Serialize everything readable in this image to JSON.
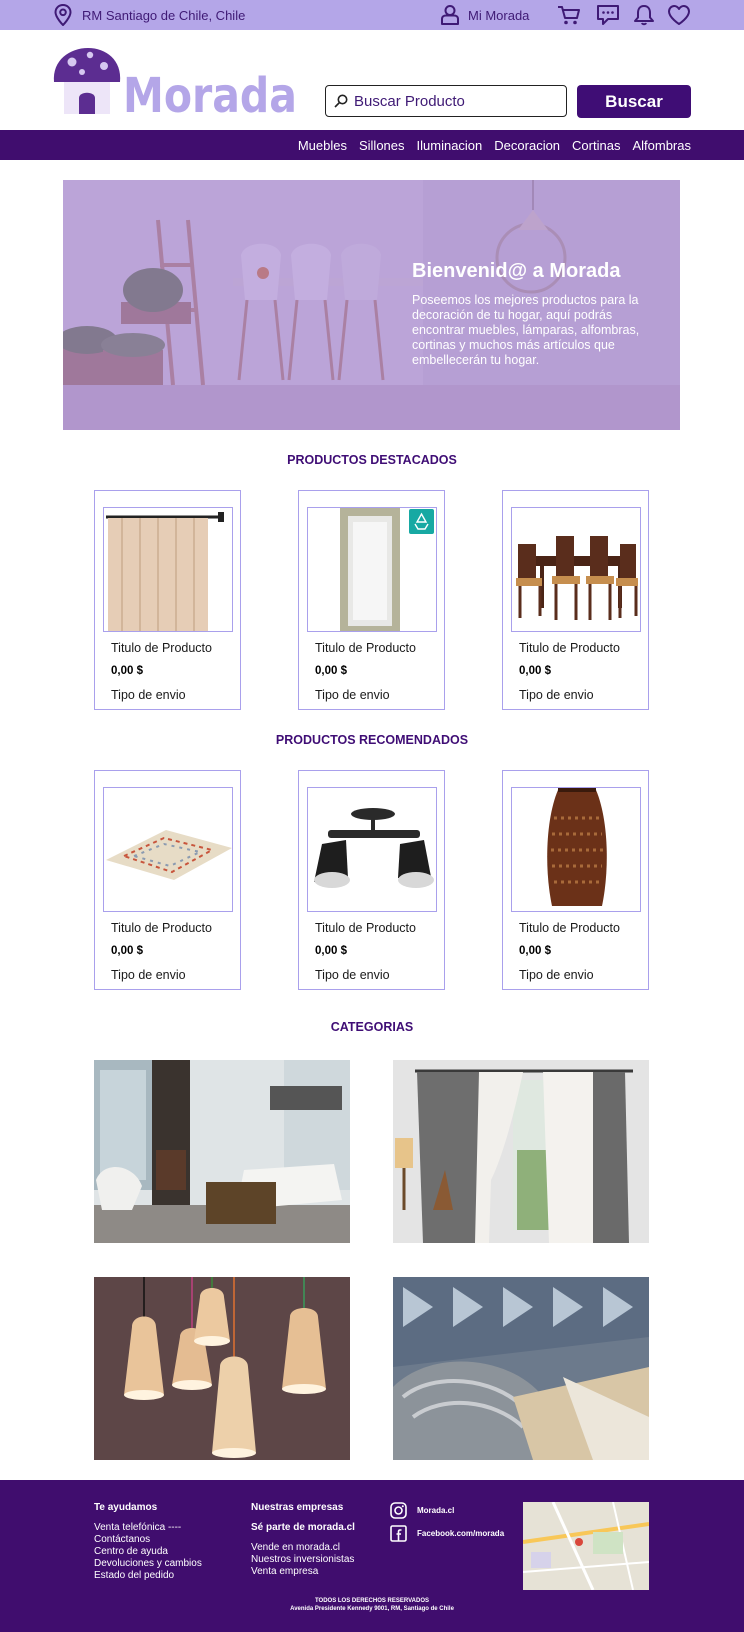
{
  "topbar": {
    "location": "RM Santiago de Chile, Chile",
    "account_label": "Mi Morada",
    "icons": [
      "location-icon",
      "user-icon",
      "cart-icon",
      "chat-icon",
      "bell-icon",
      "heart-icon"
    ]
  },
  "header": {
    "logo_text": "Morada",
    "search_placeholder": "Buscar Producto",
    "search_button": "Buscar"
  },
  "nav": {
    "items": [
      "Muebles",
      "Sillones",
      "Iluminacion",
      "Decoracion",
      "Cortinas",
      "Alfombras"
    ]
  },
  "hero": {
    "title": "Bienvenid@ a Morada",
    "text": "Poseemos los mejores productos para la decoración de tu hogar, aquí podrás encontrar muebles, lámparas, alfombras, cortinas y muchos más artículos que embellecerán tu hogar."
  },
  "featured": {
    "title": "PRODUCTOS DESTACADOS",
    "products": [
      {
        "title": "Titulo de Producto",
        "price": "0,00 $",
        "shipping": "Tipo de envio",
        "image": "curtain"
      },
      {
        "title": "Titulo de Producto",
        "price": "0,00 $",
        "shipping": "Tipo de envio",
        "image": "mirror"
      },
      {
        "title": "Titulo de Producto",
        "price": "0,00 $",
        "shipping": "Tipo de envio",
        "image": "dining-set"
      }
    ]
  },
  "recommended": {
    "title": "PRODUCTOS RECOMENDADOS",
    "products": [
      {
        "title": "Titulo de Producto",
        "price": "0,00 $",
        "shipping": "Tipo de envio",
        "image": "rug"
      },
      {
        "title": "Titulo de Producto",
        "price": "0,00 $",
        "shipping": "Tipo de envio",
        "image": "spotlight-lamp"
      },
      {
        "title": "Titulo de Producto",
        "price": "0,00 $",
        "shipping": "Tipo de envio",
        "image": "vase"
      }
    ]
  },
  "categories": {
    "title": "CATEGORIAS",
    "images": [
      "living-room",
      "curtains",
      "pendant-lamps",
      "rugs"
    ]
  },
  "footer": {
    "help_title": "Te ayudamos",
    "help_links": [
      "Venta telefónica ----",
      "Contáctanos",
      "Centro de ayuda",
      "Devoluciones y cambios",
      "Estado del pedido"
    ],
    "companies_title": "Nuestras empresas",
    "join_title": "Sé parte de morada.cl",
    "company_links": [
      "Vende en morada.cl",
      "Nuestros inversionistas",
      "Venta empresa"
    ],
    "instagram": "Morada.cl",
    "facebook": "Facebook.com/morada",
    "rights": "TODOS LOS DERECHOS RESERVADOS",
    "address": "Avenida Presidente Kennedy 9001, RM, Santiago de Chile"
  },
  "colors": {
    "topbar": "#b4a6e8",
    "primary": "#400d6e",
    "card_border": "#a9a0ec",
    "hero_overlay": "#926bc4"
  }
}
